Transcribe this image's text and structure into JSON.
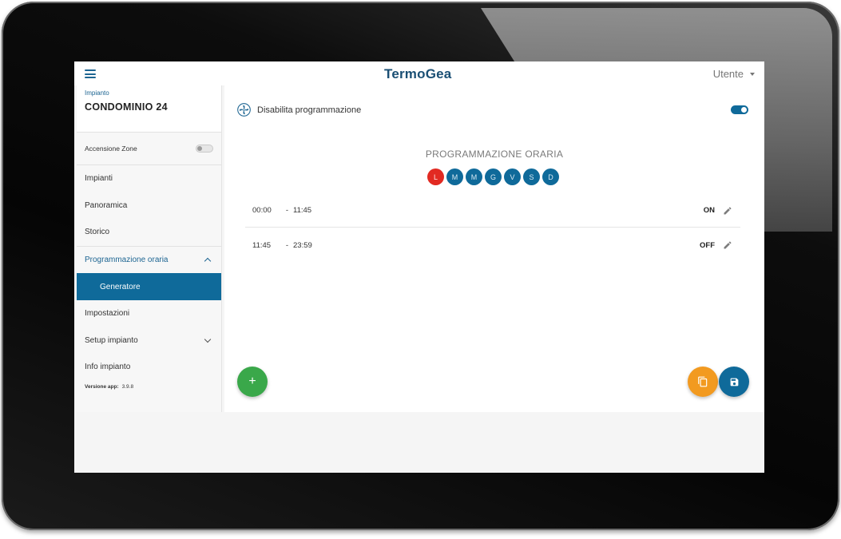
{
  "header": {
    "brand": "TermoGea",
    "user_label": "Utente"
  },
  "sidebar": {
    "plant_label": "Impianto",
    "plant_name": "CONDOMINIO 24",
    "zones_label": "Accensione Zone",
    "zones_enabled": false,
    "items": [
      {
        "label": "Impianti"
      },
      {
        "label": "Panoramica"
      },
      {
        "label": "Storico"
      },
      {
        "label": "Programmazione oraria",
        "expanded": true
      },
      {
        "label": "Generatore",
        "selected": true
      },
      {
        "label": "Impostazioni"
      },
      {
        "label": "Setup impianto",
        "expanded": false
      },
      {
        "label": "Info impianto"
      }
    ],
    "version_label": "Versione app:",
    "version_value": "3.9.8"
  },
  "main": {
    "disable_label": "Disabilita programmazione",
    "disable_enabled": true,
    "schedule_title": "PROGRAMMAZIONE ORARIA",
    "days": [
      {
        "label": "L",
        "active": true
      },
      {
        "label": "M",
        "active": false
      },
      {
        "label": "M",
        "active": false
      },
      {
        "label": "G",
        "active": false
      },
      {
        "label": "V",
        "active": false
      },
      {
        "label": "S",
        "active": false
      },
      {
        "label": "D",
        "active": false
      }
    ],
    "slots": [
      {
        "start": "00:00",
        "sep": "-",
        "end": "11:45",
        "state": "ON"
      },
      {
        "start": "11:45",
        "sep": "-",
        "end": "23:59",
        "state": "OFF"
      }
    ],
    "add_label": "+"
  },
  "icons": {
    "menu": "menu-icon",
    "fan": "fan-icon",
    "edit": "pencil-icon",
    "copy": "copy-icon",
    "save": "save-icon"
  },
  "colors": {
    "primary": "#0f6a9a",
    "brand": "#1a4f74",
    "active_day": "#e22a22",
    "add_button": "#3aa84a",
    "copy_button": "#f29a20"
  }
}
